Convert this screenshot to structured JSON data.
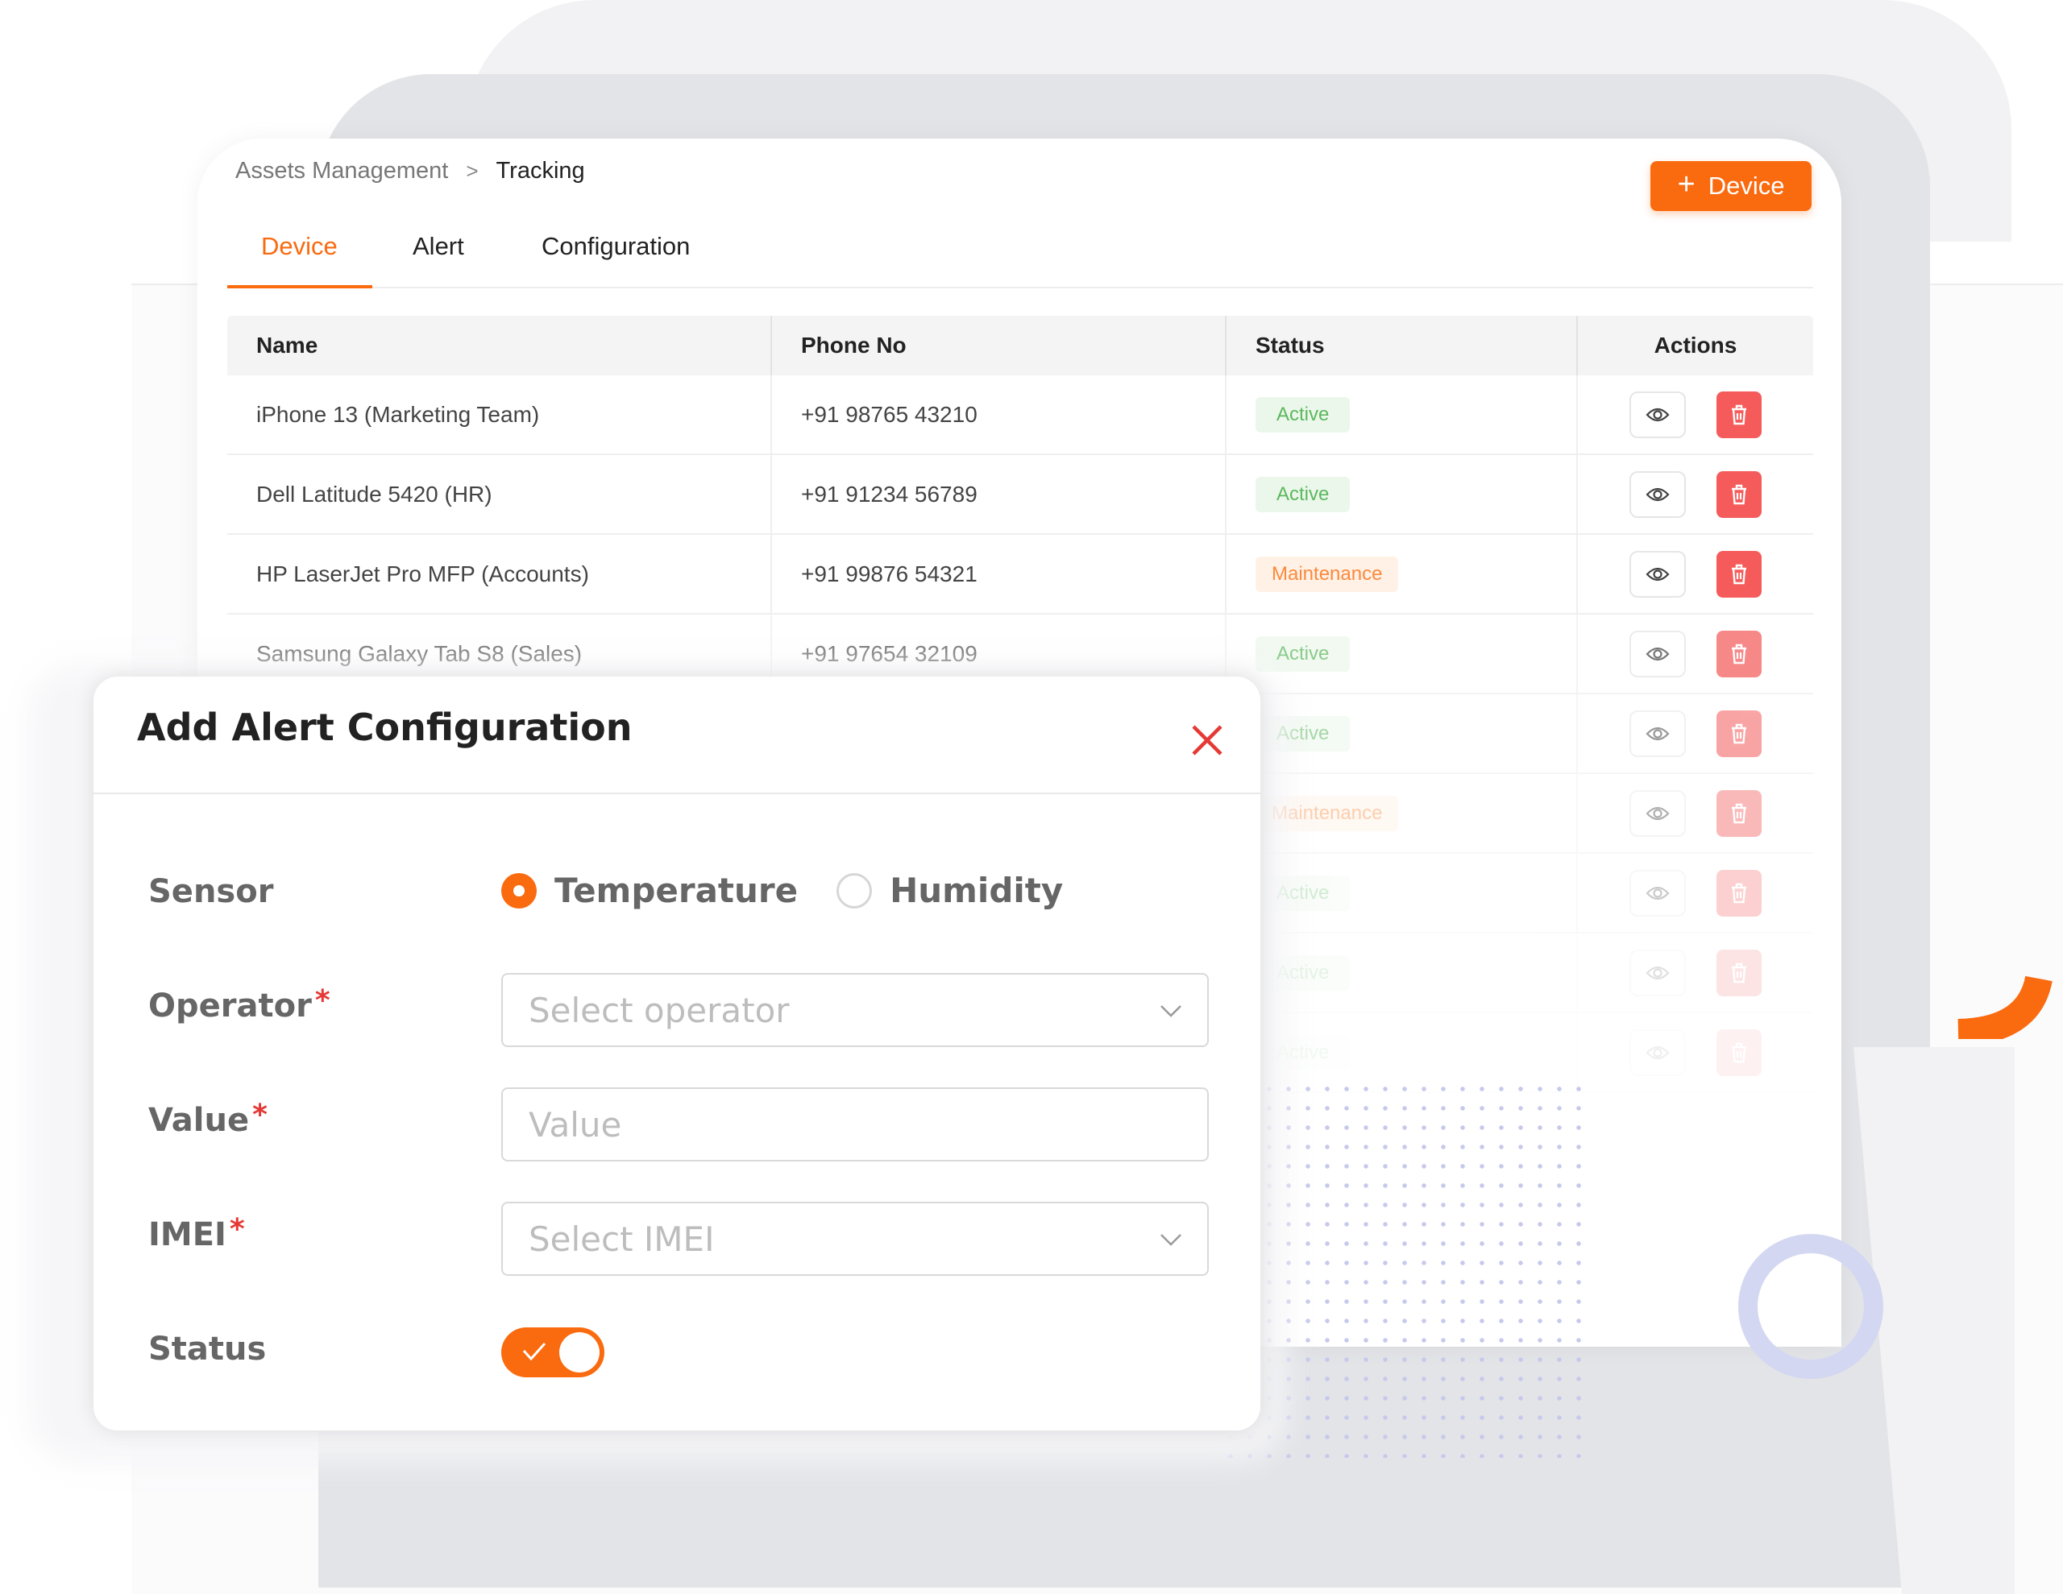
{
  "breadcrumb": {
    "parent": "Assets Management",
    "separator": ">",
    "current": "Tracking"
  },
  "add_device_button": {
    "icon": "plus-icon",
    "label": "Device"
  },
  "tabs": [
    {
      "label": "Device",
      "active": true
    },
    {
      "label": "Alert",
      "active": false
    },
    {
      "label": "Configuration",
      "active": false
    }
  ],
  "table": {
    "headers": [
      "Name",
      "Phone No",
      "Status",
      "Actions"
    ],
    "rows": [
      {
        "name": "iPhone 13 (Marketing Team)",
        "phone": "+91 98765 43210",
        "status": "Active"
      },
      {
        "name": "Dell Latitude 5420 (HR)",
        "phone": "+91 91234 56789",
        "status": "Active"
      },
      {
        "name": "HP LaserJet Pro MFP (Accounts)",
        "phone": "+91 99876 54321",
        "status": "Maintenance"
      },
      {
        "name": "Samsung Galaxy Tab S8 (Sales)",
        "phone": "+91 97654 32109",
        "status": "Active"
      },
      {
        "name": "",
        "phone": "",
        "status": "Active"
      },
      {
        "name": "",
        "phone": "",
        "status": "Maintenance"
      },
      {
        "name": "",
        "phone": "",
        "status": "Active"
      },
      {
        "name": "",
        "phone": "",
        "status": "Active"
      },
      {
        "name": "",
        "phone": "",
        "status": "Active"
      }
    ],
    "row_icons": {
      "view": "eye-icon",
      "delete": "trash-icon"
    }
  },
  "modal": {
    "title": "Add Alert Configuration",
    "close_icon": "close-icon",
    "sensor": {
      "label": "Sensor",
      "options": [
        {
          "label": "Temperature",
          "selected": true
        },
        {
          "label": "Humidity",
          "selected": false
        }
      ]
    },
    "operator": {
      "label": "Operator",
      "required": "*",
      "placeholder": "Select operator"
    },
    "value": {
      "label": "Value",
      "required": "*",
      "placeholder": "Value"
    },
    "imei": {
      "label": "IMEI",
      "required": "*",
      "placeholder": "Select IMEI"
    },
    "status": {
      "label": "Status",
      "enabled": true
    }
  },
  "colors": {
    "accent": "#fa6a0f",
    "active_text": "#5cb85c",
    "maintenance_text": "#fb8a3c",
    "delete": "#f55b5b",
    "required": "#e53935"
  }
}
